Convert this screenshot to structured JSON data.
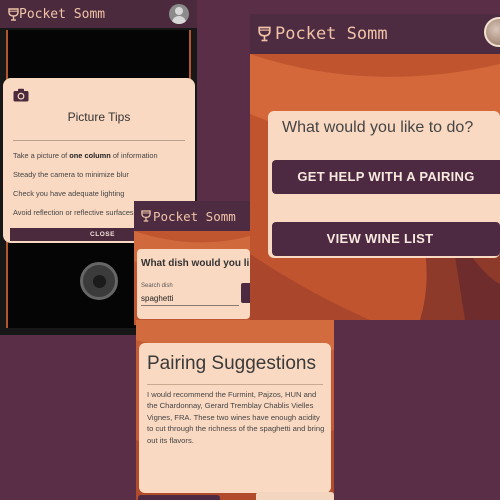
{
  "app": {
    "name": "Pocket Somm"
  },
  "camera_screen": {
    "tips": {
      "title": "Picture Tips",
      "items": [
        {
          "before": "Take a picture of ",
          "bold": "one column",
          "after": " of information"
        },
        {
          "before": "Steady the camera to minimize blur",
          "bold": "",
          "after": ""
        },
        {
          "before": "Check you have adequate lighting",
          "bold": "",
          "after": ""
        },
        {
          "before": "Avoid reflection or reflective surfaces",
          "bold": "",
          "after": ""
        }
      ],
      "close_label": "CLOSE"
    }
  },
  "menu_screen": {
    "question": "What would you like to do?",
    "pairing_button": "GET HELP WITH A PAIRING",
    "wine_list_button": "VIEW WINE LIST"
  },
  "search_screen": {
    "question": "What dish would you like",
    "search_label": "Search dish",
    "search_value": "spaghetti"
  },
  "pairing_screen": {
    "title": "Pairing Suggestions",
    "text": "I would recommend the Furmint, Pajzos, HUN and the Chardonnay, Gerard Tremblay Chablis Vielles Vignes, FRA. These two wines have enough acidity to cut through the richness of the spaghetti and bring out its flavors."
  },
  "colors": {
    "background": "#5b2e48",
    "topbar": "#4a2a3c",
    "accent": "#c0542e",
    "card": "#fad9c2",
    "button": "#4e2a42",
    "brand_text": "#f0c3a7"
  }
}
